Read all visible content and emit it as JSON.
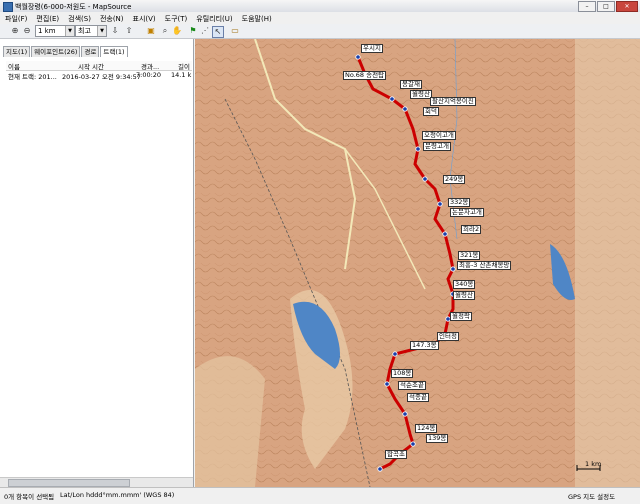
{
  "window": {
    "title": "백월장령(6-000-저원도 - MapSource"
  },
  "menu": [
    "파일(F)",
    "편집(E)",
    "검색(S)",
    "전송(N)",
    "표시(V)",
    "도구(T)",
    "유틸리티(U)",
    "도움말(H)"
  ],
  "toolbar": {
    "zoom_value": "1 km",
    "detail_value": "최고"
  },
  "left_panel": {
    "tabs": [
      "지도(1)",
      "웨이포인트(26)",
      "경로",
      "트랙(1)"
    ],
    "columns": [
      "이름",
      "시작 시간",
      "경과...",
      "길이"
    ],
    "rows": [
      {
        "name": "현재 트랙: 201...",
        "start": "2016-03-27 오전 9:34:57",
        "elapsed": "7:00:20",
        "length": "14.1 k"
      }
    ]
  },
  "map": {
    "scale_label": "1 km",
    "track_color": "#cc0000",
    "water_color": "#4f86c6",
    "waypoints": [
      "우시지",
      "No.68 송전탑",
      "봉갈재",
      "월령산",
      "팔산지억봉이진",
      "회덕",
      "오청이고개",
      "문령고개",
      "249봉",
      "332봉",
      "논문자고개",
      "희라2",
      "321봉",
      "최흥-3 산촌채봉망",
      "340봉",
      "월령산",
      "월정락",
      "인터정",
      "147.3봉",
      "108봉",
      "석순조끝",
      "석종끝",
      "124봉",
      "139봉",
      "합곡초"
    ]
  },
  "status": {
    "selection": "0개 항목이 선택됨",
    "coords": "Lat/Lon hddd°mm.mmm' (WGS 84)",
    "gps": "GPS 지도 설정도"
  }
}
